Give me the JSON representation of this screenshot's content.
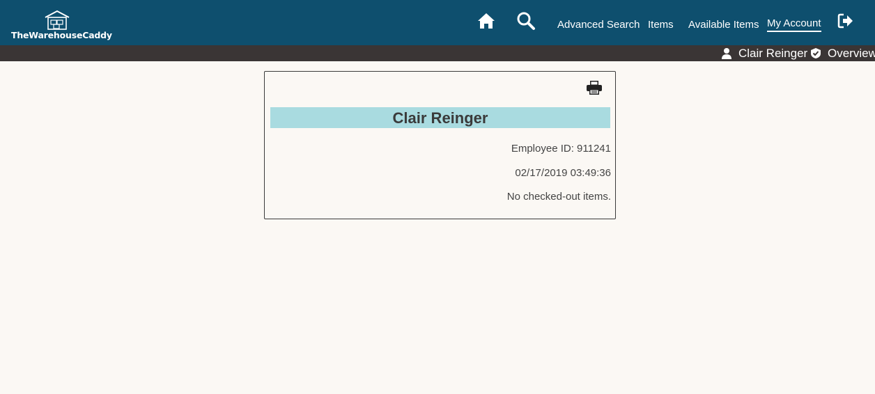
{
  "header": {
    "brand": "TheWarehouseCaddy",
    "icons": {
      "logo": "warehouse-icon",
      "home": "home-icon",
      "search": "search-icon",
      "logout": "logout-icon"
    },
    "nav": [
      {
        "label": "Advanced Search"
      },
      {
        "label": "Items"
      },
      {
        "label": "Available Items"
      },
      {
        "label": "My Account",
        "active": true
      }
    ]
  },
  "subnav": {
    "user_name": "Clair Reinger",
    "overview_label": "Overview",
    "icons": {
      "user": "user-icon",
      "overview": "check-shield-icon"
    }
  },
  "account_card": {
    "name": "Clair Reinger",
    "employee_id": "Employee ID: 911241",
    "datetime": "02/17/2019 03:49:36",
    "status": "No checked-out items.",
    "print_icon": "print-icon"
  },
  "colors": {
    "header_bg": "#0e4f6e",
    "subbar_bg": "#3a3535",
    "banner_bg": "#a9dbe0",
    "page_bg": "#fbf8f4"
  }
}
